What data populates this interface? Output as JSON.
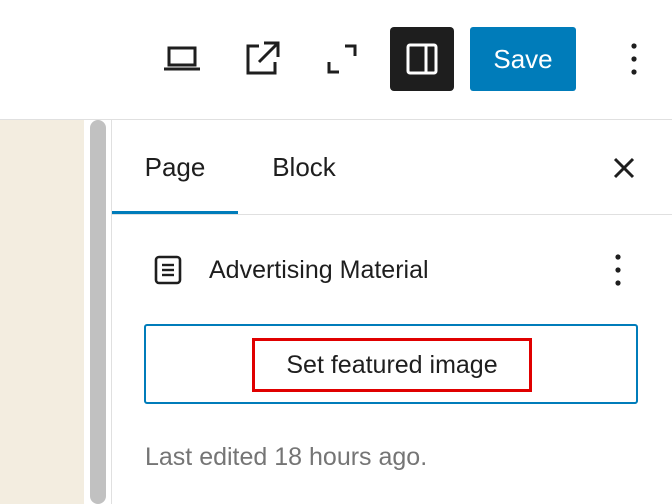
{
  "toolbar": {
    "save_label": "Save",
    "icons": {
      "preview": "laptop-icon",
      "view_page": "external-link-icon",
      "fullscreen": "fullscreen-icon",
      "settings": "sidebar-toggle-icon",
      "options": "more-vertical-icon"
    }
  },
  "sidebar": {
    "tabs": [
      {
        "label": "Page",
        "active": true
      },
      {
        "label": "Block",
        "active": false
      }
    ],
    "document": {
      "icon": "page-icon",
      "title": "Advertising Material"
    },
    "featured_image_button": "Set featured image",
    "last_edited": "Last edited 18 hours ago."
  },
  "colors": {
    "accent": "#007cba",
    "canvas": "#f3ede0",
    "highlight": "#e00000"
  }
}
